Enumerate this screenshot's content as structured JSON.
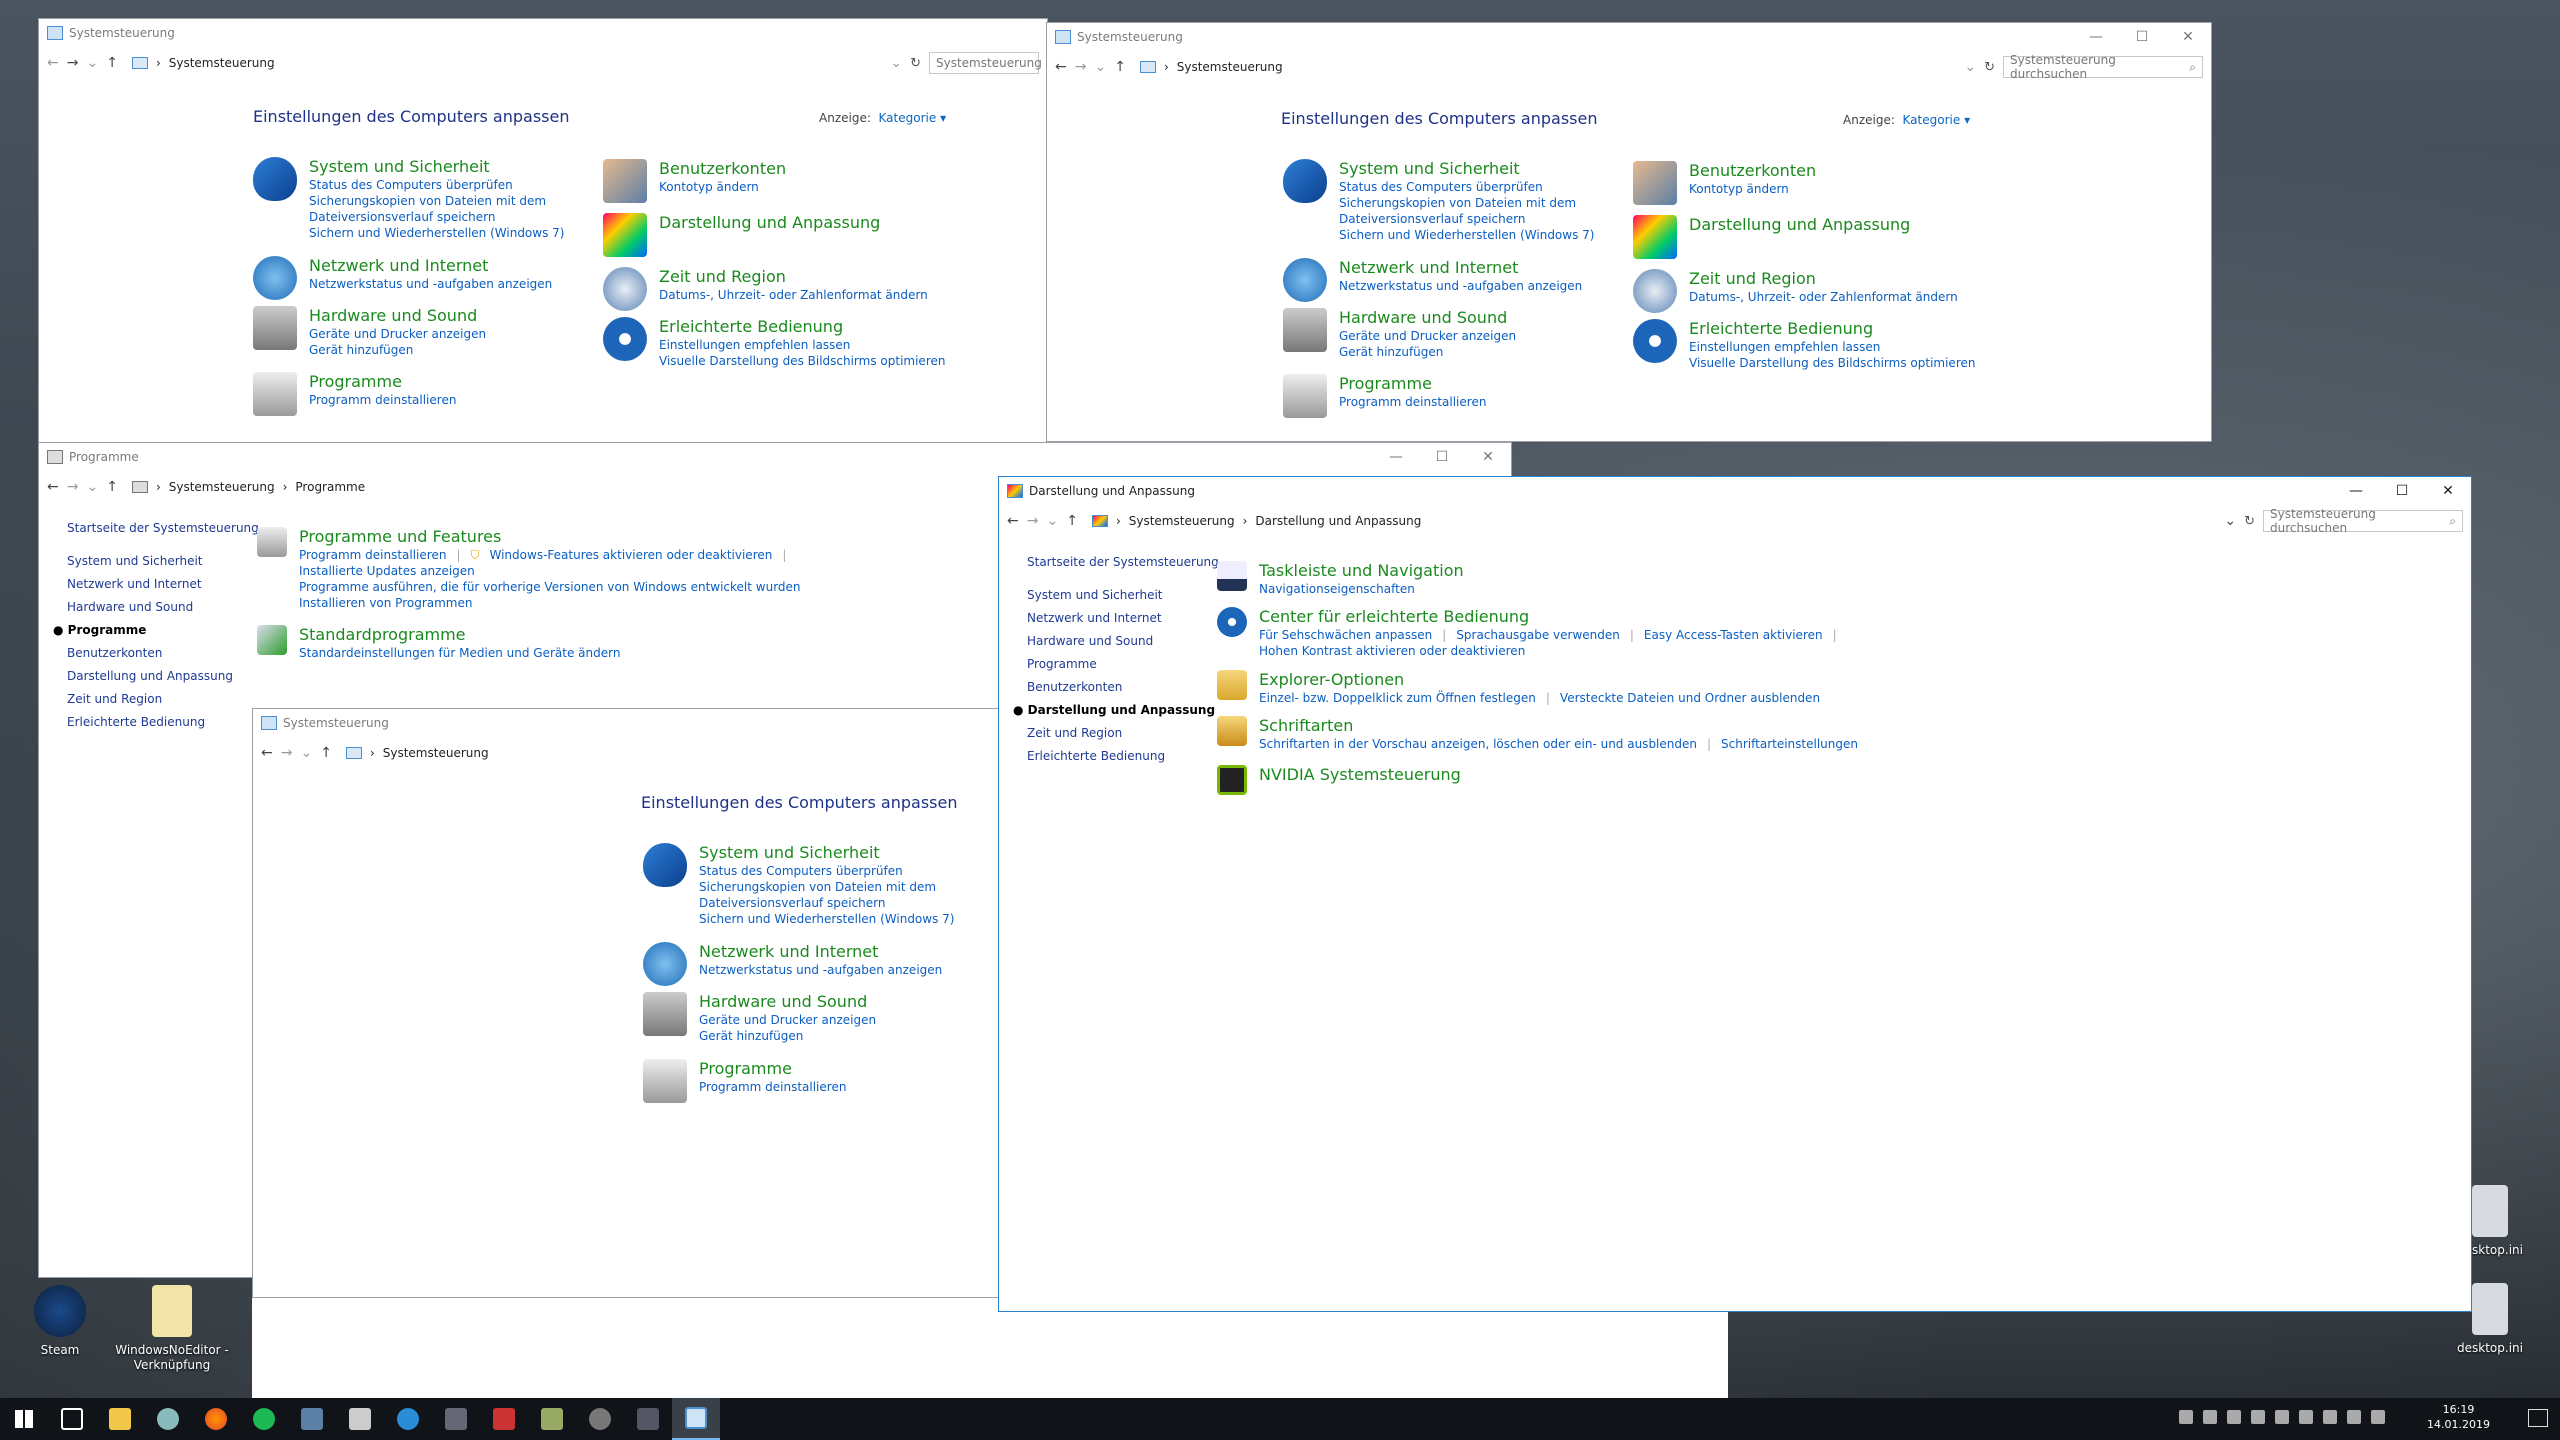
{
  "desktop": {
    "icons": [
      {
        "label": "Steam"
      },
      {
        "label": "WindowsNoEditor - Verknüpfung"
      },
      {
        "label": "desktop.ini"
      },
      {
        "label": "desktop.ini"
      }
    ]
  },
  "cp": {
    "window_title": "Systemsteuerung",
    "crumb": "Systemsteuerung",
    "search_placeholder": "Systemsteuerung durchsuchen",
    "search_short": "Systemsteuerung",
    "heading": "Einstellungen des Computers anpassen",
    "view_label": "Anzeige:",
    "view_value": "Kategorie",
    "categories": {
      "security": {
        "title": "System und Sicherheit",
        "links": [
          "Status des Computers überprüfen",
          "Sicherungskopien von Dateien mit dem",
          "Dateiversionsverlauf speichern",
          "Sichern und Wiederherstellen (Windows 7)"
        ]
      },
      "network": {
        "title": "Netzwerk und Internet",
        "links": [
          "Netzwerkstatus und -aufgaben anzeigen"
        ]
      },
      "hardware": {
        "title": "Hardware und Sound",
        "links": [
          "Geräte und Drucker anzeigen",
          "Gerät hinzufügen"
        ]
      },
      "programs": {
        "title": "Programme",
        "links": [
          "Programm deinstallieren"
        ]
      },
      "accounts": {
        "title": "Benutzerkonten",
        "links": [
          "Kontotyp ändern"
        ]
      },
      "appearance": {
        "title": "Darstellung und Anpassung",
        "links": []
      },
      "clock": {
        "title": "Zeit und Region",
        "links": [
          "Datums-, Uhrzeit- oder Zahlenformat ändern"
        ]
      },
      "ease": {
        "title": "Erleichterte Bedienung",
        "links": [
          "Einstellungen empfehlen lassen",
          "Visuelle Darstellung des Bildschirms optimieren"
        ]
      }
    }
  },
  "prog": {
    "window_title": "Programme",
    "crumbs": [
      "Systemsteuerung",
      "Programme"
    ],
    "sidebar": [
      "Startseite der Systemsteuerung",
      "System und Sicherheit",
      "Netzwerk und Internet",
      "Hardware und Sound",
      "Programme",
      "Benutzerkonten",
      "Darstellung und Anpassung",
      "Zeit und Region",
      "Erleichterte Bedienung"
    ],
    "features": {
      "title": "Programme und Features",
      "links": [
        "Programm deinstallieren",
        "Windows-Features aktivieren oder deaktivieren",
        "Installierte Updates anzeigen",
        "Programme ausführen, die für vorherige Versionen von Windows entwickelt wurden",
        "Installieren von Programmen"
      ]
    },
    "defaults": {
      "title": "Standardprogramme",
      "links": [
        "Standardeinstellungen für Medien und Geräte ändern"
      ]
    }
  },
  "app": {
    "window_title": "Darstellung und Anpassung",
    "crumbs": [
      "Systemsteuerung",
      "Darstellung und Anpassung"
    ],
    "search_placeholder": "Systemsteuerung durchsuchen",
    "sidebar": [
      "Startseite der Systemsteuerung",
      "System und Sicherheit",
      "Netzwerk und Internet",
      "Hardware und Sound",
      "Programme",
      "Benutzerkonten",
      "Darstellung und Anpassung",
      "Zeit und Region",
      "Erleichterte Bedienung"
    ],
    "items": [
      {
        "title": "Taskleiste und Navigation",
        "links": [
          "Navigationseigenschaften"
        ]
      },
      {
        "title": "Center für erleichterte Bedienung",
        "links": [
          "Für Sehschwächen anpassen",
          "Sprachausgabe verwenden",
          "Easy Access-Tasten aktivieren",
          "Hohen Kontrast aktivieren oder deaktivieren"
        ]
      },
      {
        "title": "Explorer-Optionen",
        "links": [
          "Einzel- bzw. Doppelklick zum Öffnen festlegen",
          "Versteckte Dateien und Ordner ausblenden"
        ]
      },
      {
        "title": "Schriftarten",
        "links": [
          "Schriftarten in der Vorschau anzeigen, löschen oder ein- und ausblenden",
          "Schriftarteinstellungen"
        ]
      },
      {
        "title": "NVIDIA Systemsteuerung",
        "links": []
      }
    ]
  },
  "taskbar": {
    "time": "16:19",
    "date": "14.01.2019"
  },
  "colors": {
    "link": "#0b5ec2",
    "category": "#1b8a1e",
    "heading": "#1e3287",
    "accent": "#2b7fd0"
  }
}
